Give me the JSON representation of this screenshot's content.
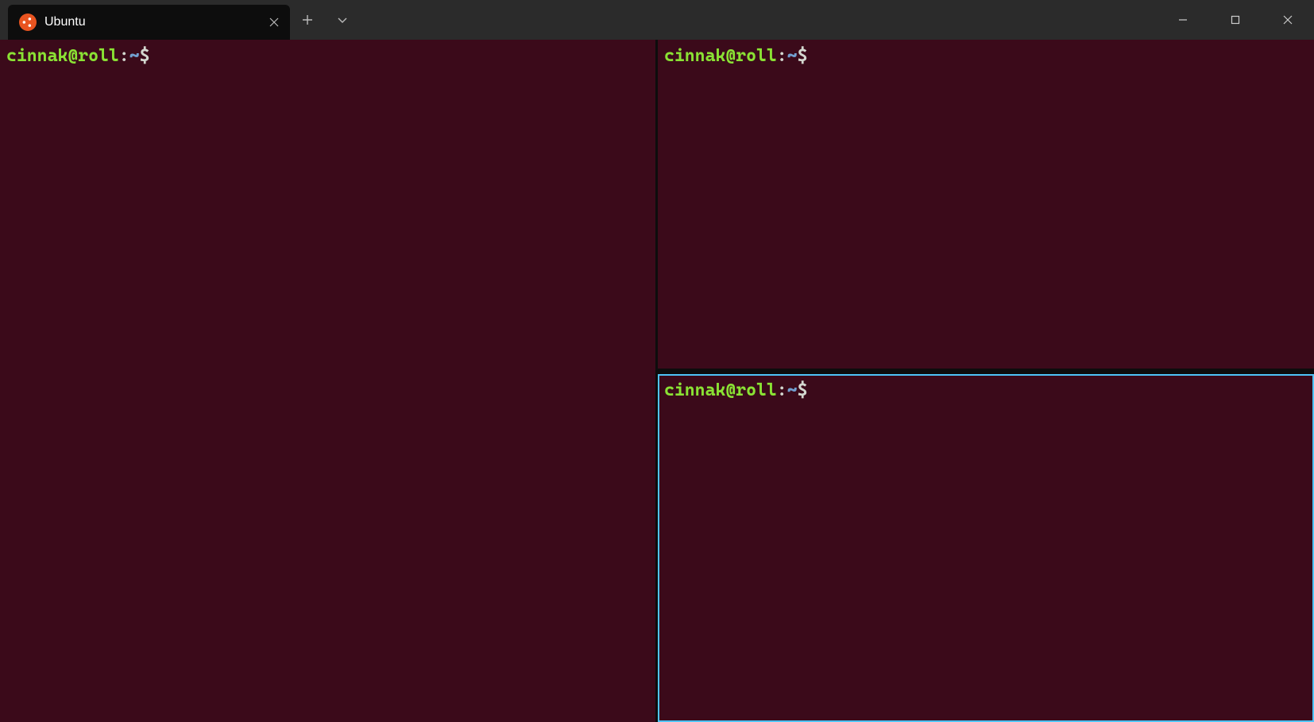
{
  "tab": {
    "label": "Ubuntu",
    "icon_name": "ubuntu-icon"
  },
  "panes": [
    {
      "id": "left",
      "prompt_user_host": "cinnak@roll",
      "prompt_colon": ":",
      "prompt_path": "~",
      "prompt_symbol": "$",
      "has_cursor": false,
      "active": false
    },
    {
      "id": "top-right",
      "prompt_user_host": "cinnak@roll",
      "prompt_colon": ":",
      "prompt_path": "~",
      "prompt_symbol": "$",
      "has_cursor": false,
      "active": false
    },
    {
      "id": "bottom-right",
      "prompt_user_host": "cinnak@roll",
      "prompt_colon": ":",
      "prompt_path": "~",
      "prompt_symbol": "$",
      "has_cursor": true,
      "active": true
    }
  ],
  "colors": {
    "terminal_bg": "#3b0a1a",
    "tab_bg": "#0d0d0d",
    "titlebar_bg": "#2b2b2b",
    "active_border": "#4fc3f7",
    "prompt_user": "#8ae234",
    "prompt_path": "#729fcf",
    "prompt_text": "#d3d7cf",
    "ubuntu_orange": "#e95420"
  }
}
